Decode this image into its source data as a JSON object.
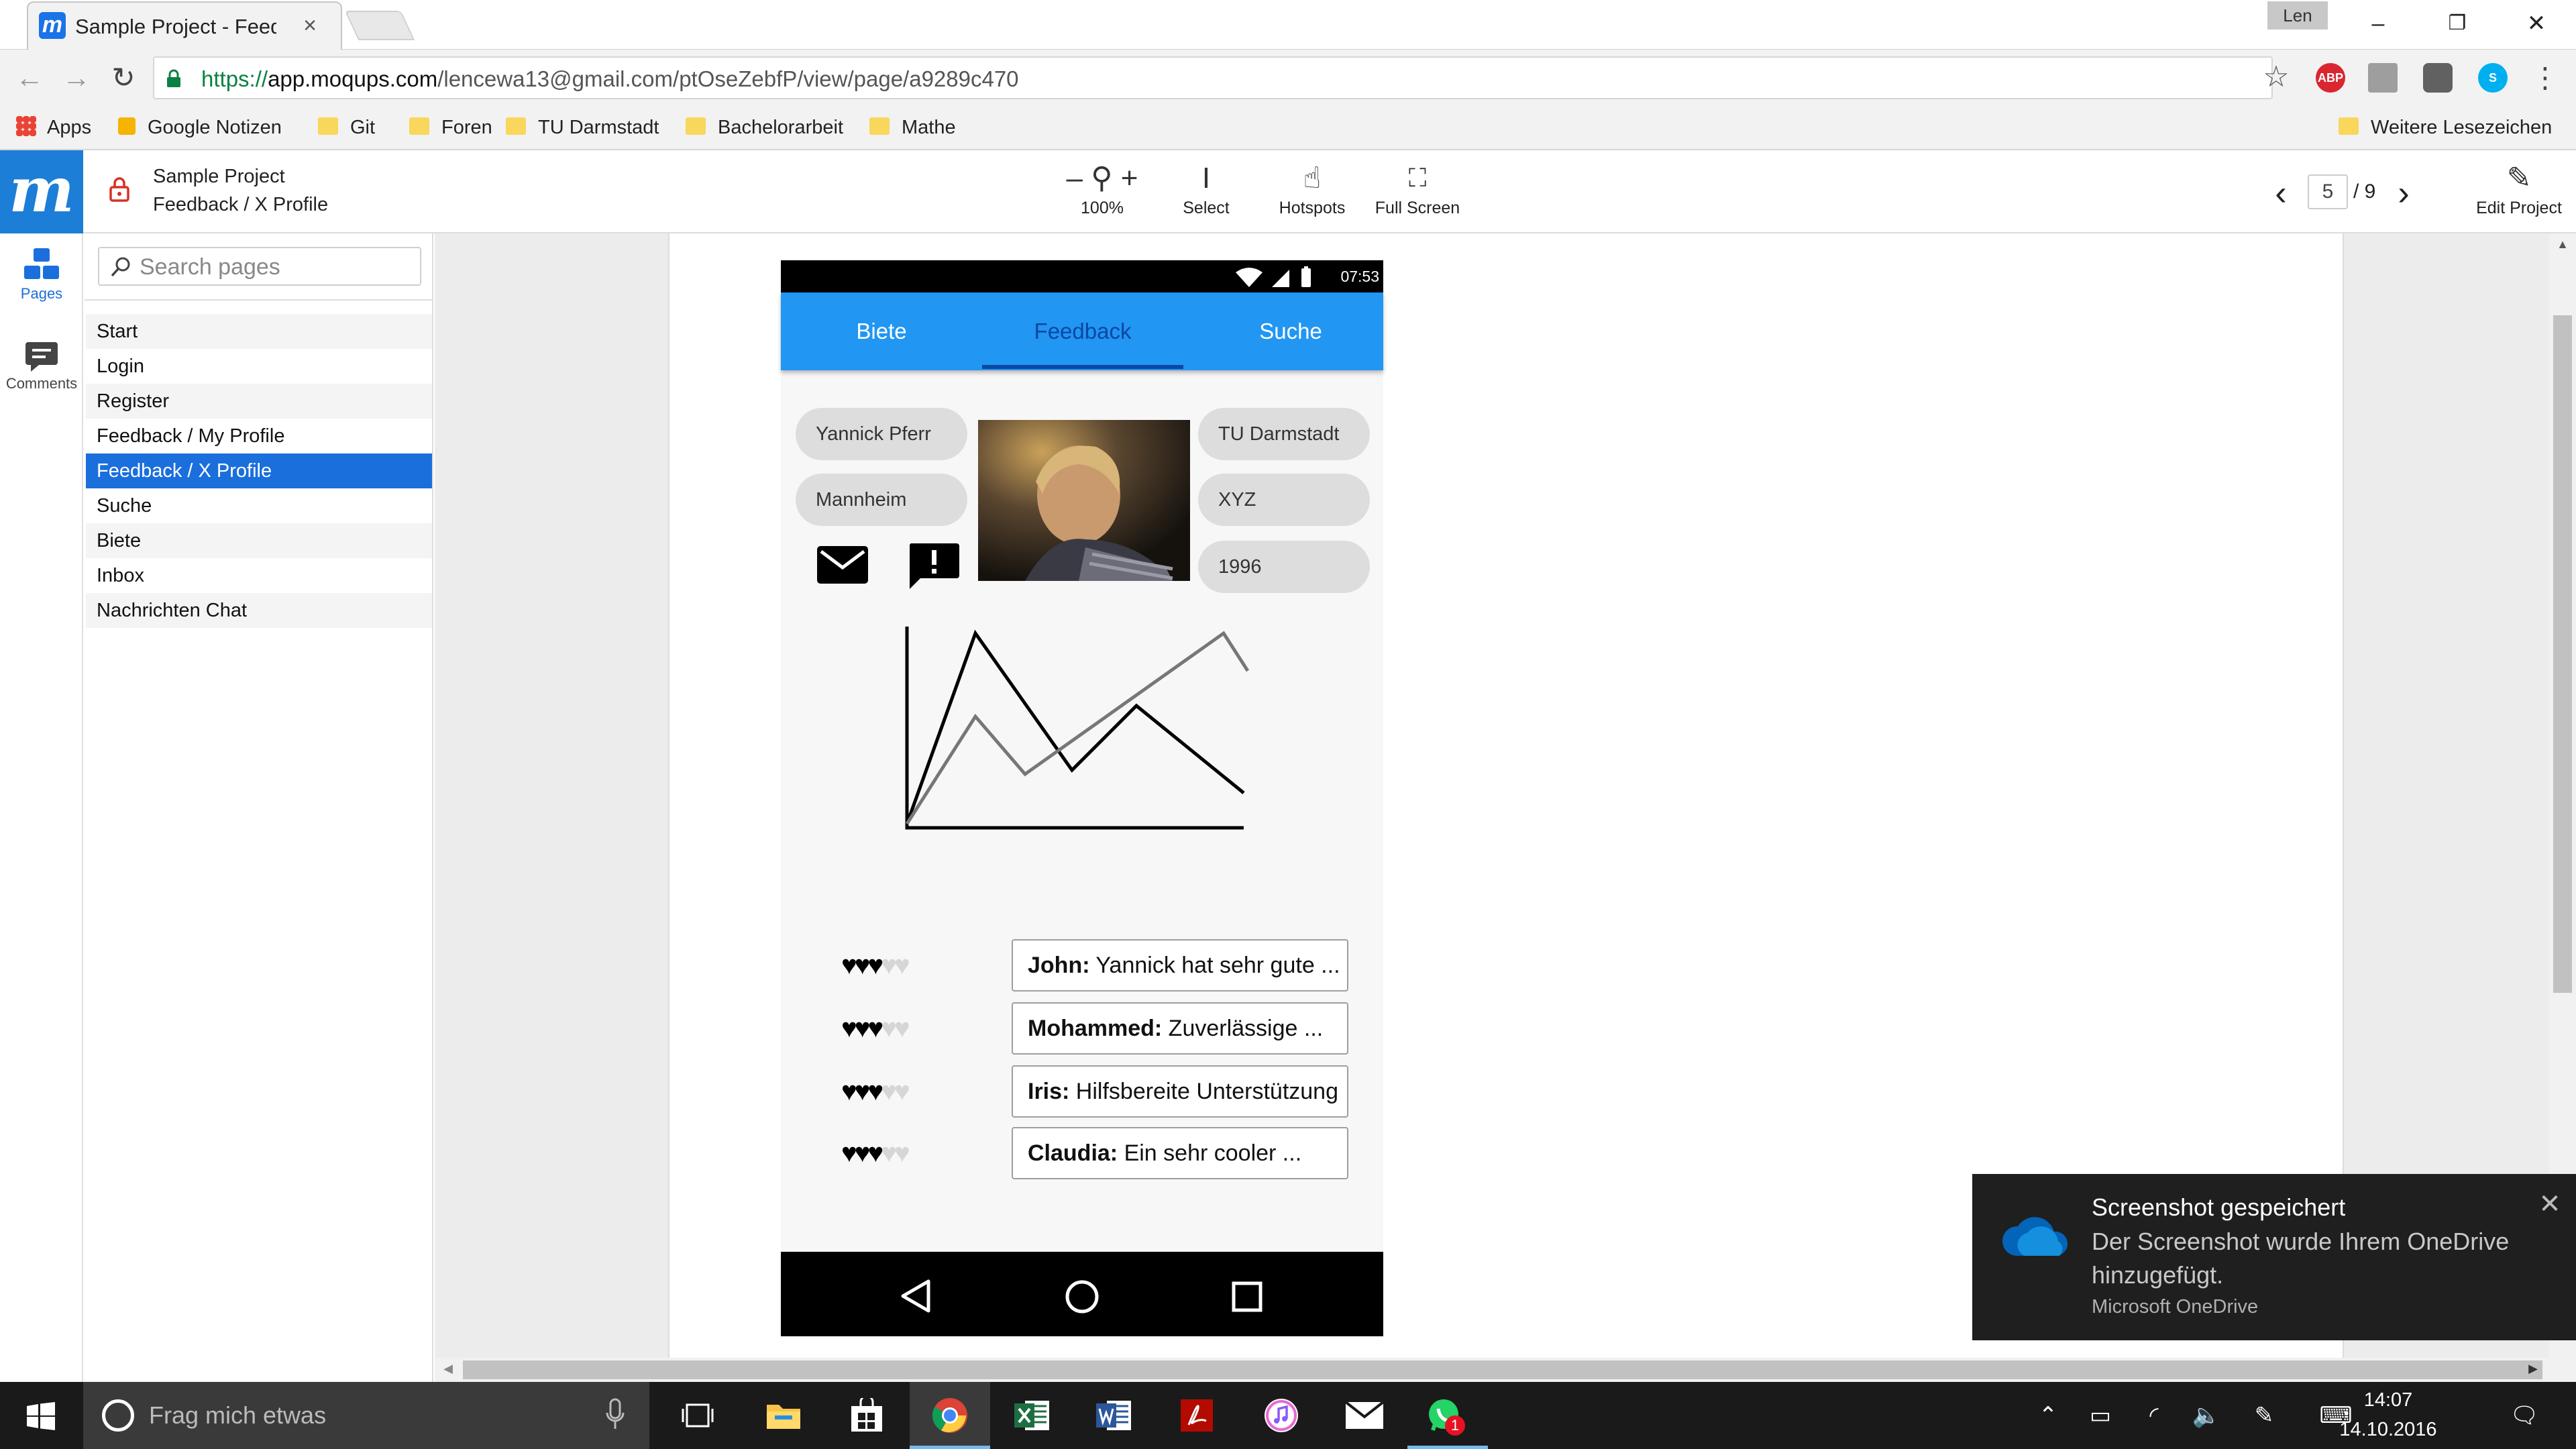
{
  "browser": {
    "tab_title": "Sample Project - Feedba",
    "tab_close": "×",
    "user_badge": "Len",
    "window_controls": {
      "minimize": "–",
      "restore": "❐",
      "close": "✕"
    },
    "url_scheme": "https://",
    "url_host": "app.moqups.com",
    "url_path": "/lencewa13@gmail.com/ptOseZebfP/view/page/a9289c470",
    "bookmarks": [
      {
        "label": "Apps",
        "icon": "apps-grid-icon"
      },
      {
        "label": "Google Notizen",
        "icon": "keep-icon"
      },
      {
        "label": "Git",
        "icon": "folder-icon"
      },
      {
        "label": "Foren",
        "icon": "folder-icon"
      },
      {
        "label": "TU Darmstadt",
        "icon": "folder-icon"
      },
      {
        "label": "Bachelorarbeit",
        "icon": "folder-icon"
      },
      {
        "label": "Mathe",
        "icon": "folder-icon"
      }
    ],
    "bookmarks_more": "Weitere Lesezeichen",
    "extensions": [
      "ABP"
    ]
  },
  "moqups": {
    "logo": "m",
    "project_name": "Sample Project",
    "page_path": "Feedback / X Profile",
    "toolbar": {
      "zoom_label": "100%",
      "select_label": "Select",
      "hotspots_label": "Hotspots",
      "fullscreen_label": "Full Screen",
      "edit_label": "Edit Project"
    },
    "pager": {
      "current": "5",
      "total": "/ 9"
    },
    "rail": {
      "pages_label": "Pages",
      "comments_label": "Comments"
    },
    "search": {
      "placeholder": "Search pages"
    },
    "pages": [
      "Start",
      "Login",
      "Register",
      "Feedback / My Profile",
      "Feedback / X Profile",
      "Suche",
      "Biete",
      "Inbox",
      "Nachrichten Chat"
    ],
    "active_page_index": 4
  },
  "phone": {
    "status_time": "07:53",
    "tabs": [
      "Biete",
      "Feedback",
      "Suche"
    ],
    "active_tab": 1,
    "profile": {
      "name": "Yannick Pferr",
      "city": "Mannheim",
      "university": "TU Darmstadt",
      "field": "XYZ",
      "year": "1996"
    },
    "comments": [
      {
        "author": "John:",
        "text": " Yannick hat sehr gute ...",
        "rating": 3,
        "max": 5
      },
      {
        "author": "Mohammed:",
        "text": " Zuverlässige ...",
        "rating": 3,
        "max": 5
      },
      {
        "author": "Iris:",
        "text": " Hilfsbereite Unterstützung",
        "rating": 3,
        "max": 5
      },
      {
        "author": "Claudia:",
        "text": " Ein sehr cooler ...",
        "rating": 3,
        "max": 5
      }
    ]
  },
  "toast": {
    "title": "Screenshot gespeichert",
    "body": "Der Screenshot wurde Ihrem OneDrive hinzugefügt.",
    "source": "Microsoft OneDrive",
    "close": "✕"
  },
  "taskbar": {
    "search_placeholder": "Frag mich etwas",
    "time": "14:07",
    "date": "14.10.2016",
    "whatsapp_badge": "1"
  }
}
